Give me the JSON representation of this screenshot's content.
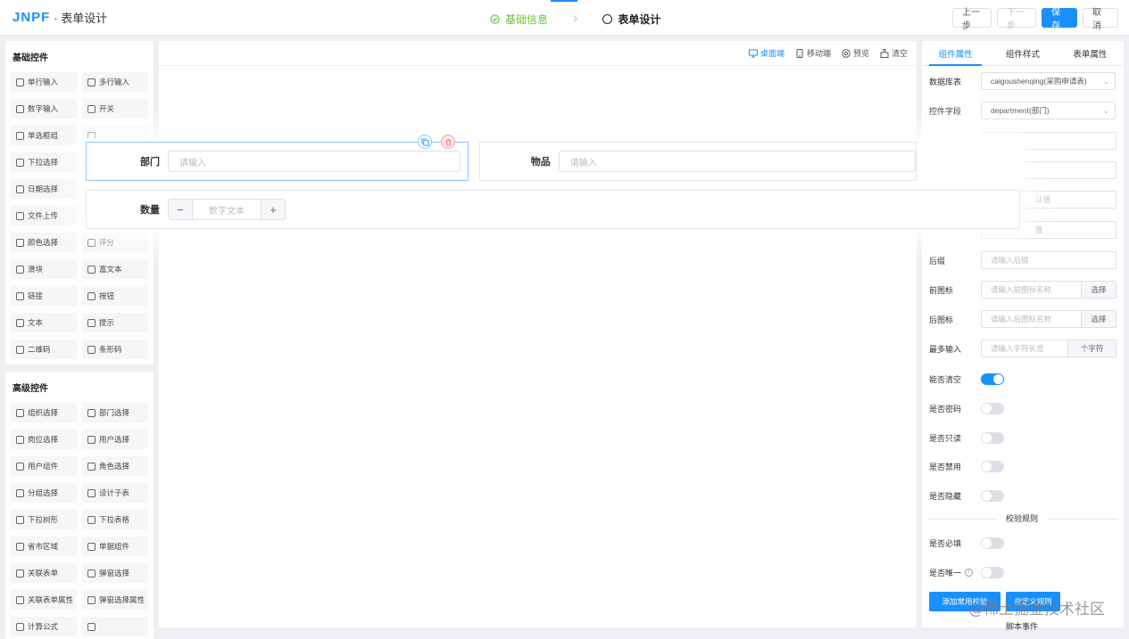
{
  "app": {
    "logo": "JNPF",
    "title": "· 表单设计"
  },
  "steps": [
    {
      "label": "基础信息",
      "state": "done"
    },
    {
      "label": "表单设计",
      "state": "active"
    }
  ],
  "top_buttons": {
    "prev": "上一步",
    "next": "下一步",
    "save": "保存",
    "cancel": "取消"
  },
  "basic": {
    "title": "基础控件",
    "items": [
      {
        "label": "单行输入",
        "icon": "input-icon"
      },
      {
        "label": "多行输入",
        "icon": "textarea-icon"
      },
      {
        "label": "数字输入",
        "icon": "number-icon"
      },
      {
        "label": "开关",
        "icon": "switch-icon"
      },
      {
        "label": "单选框组",
        "icon": "radio-icon"
      },
      {
        "label": "",
        "icon": "checkbox-icon"
      },
      {
        "label": "下拉选择",
        "icon": "select-icon"
      },
      {
        "label": "",
        "icon": "cascader-icon"
      },
      {
        "label": "日期选择",
        "icon": "calendar-icon"
      },
      {
        "label": "",
        "icon": "time-icon"
      },
      {
        "label": "文件上传",
        "icon": "upload-icon"
      },
      {
        "label": "",
        "icon": "image-icon"
      },
      {
        "label": "颜色选择",
        "icon": "palette-icon"
      },
      {
        "label": "评分",
        "icon": "star-icon"
      },
      {
        "label": "滑块",
        "icon": "slider-icon"
      },
      {
        "label": "富文本",
        "icon": "richtext-icon"
      },
      {
        "label": "链接",
        "icon": "link-icon"
      },
      {
        "label": "按钮",
        "icon": "button-icon"
      },
      {
        "label": "文本",
        "icon": "text-icon"
      },
      {
        "label": "提示",
        "icon": "info-icon"
      },
      {
        "label": "二维码",
        "icon": "qrcode-icon"
      },
      {
        "label": "条形码",
        "icon": "barcode-icon"
      }
    ]
  },
  "advanced": {
    "title": "高级控件",
    "items": [
      {
        "label": "组织选择",
        "icon": "org-icon"
      },
      {
        "label": "部门选择",
        "icon": "dept-icon"
      },
      {
        "label": "岗位选择",
        "icon": "position-icon"
      },
      {
        "label": "用户选择",
        "icon": "user-icon"
      },
      {
        "label": "用户组件",
        "icon": "user-group-icon"
      },
      {
        "label": "角色选择",
        "icon": "role-icon"
      },
      {
        "label": "分组选择",
        "icon": "group-icon"
      },
      {
        "label": "设计子表",
        "icon": "table-icon"
      },
      {
        "label": "下拉树形",
        "icon": "tree-icon"
      },
      {
        "label": "下拉表格",
        "icon": "dropdown-table-icon"
      },
      {
        "label": "省市区域",
        "icon": "region-icon"
      },
      {
        "label": "单据组件",
        "icon": "bill-icon"
      },
      {
        "label": "关联表单",
        "icon": "relation-form-icon"
      },
      {
        "label": "弹窗选择",
        "icon": "popup-icon"
      },
      {
        "label": "关联表单属性",
        "icon": "relation-attr-icon"
      },
      {
        "label": "弹窗选择属性",
        "icon": "popup-attr-icon"
      },
      {
        "label": "计算公式",
        "icon": "formula-icon"
      },
      {
        "label": "",
        "icon": "blank-icon"
      }
    ]
  },
  "canvas_tools": {
    "desktop": "桌面端",
    "mobile": "移动端",
    "preview": "预览",
    "clear": "清空"
  },
  "form": {
    "dept_label": "部门",
    "dept_placeholder": "请输入",
    "goods_label": "物品",
    "goods_placeholder": "请输入",
    "qty_label": "数量",
    "qty_placeholder": "数字文本",
    "minus": "−",
    "plus": "+"
  },
  "right_tabs": [
    "组件属性",
    "组件样式",
    "表单属性"
  ],
  "props": {
    "db_label": "数据库表",
    "db_value": "caigoushenqing(采购申请表)",
    "field_label": "控件字段",
    "field_value": "department(部门)",
    "ph3": "",
    "ph4": "",
    "ph5": "认值",
    "ph6": "置",
    "suffix_label": "后缀",
    "suffix_ph": "请输入后缀",
    "preicon_label": "前图标",
    "preicon_ph": "请输入前图标名称",
    "preicon_btn": "选择",
    "posticon_label": "后图标",
    "posticon_ph": "请输入后图标名称",
    "posticon_btn": "选择",
    "max_label": "最多输入",
    "max_ph": "请输入字符长度",
    "max_unit": "个字符",
    "clearable_label": "能否清空",
    "password_label": "是否密码",
    "readonly_label": "是否只读",
    "disabled_label": "是否禁用",
    "hidden_label": "是否隐藏",
    "rules_title": "校验规则",
    "required_label": "是否必填",
    "unique_label": "是否唯一",
    "add_common_btn": "添加常用校验",
    "add_custom_btn": "自定义规则",
    "events_title": "脚本事件"
  },
  "watermark": "@稀土掘金技术社区"
}
